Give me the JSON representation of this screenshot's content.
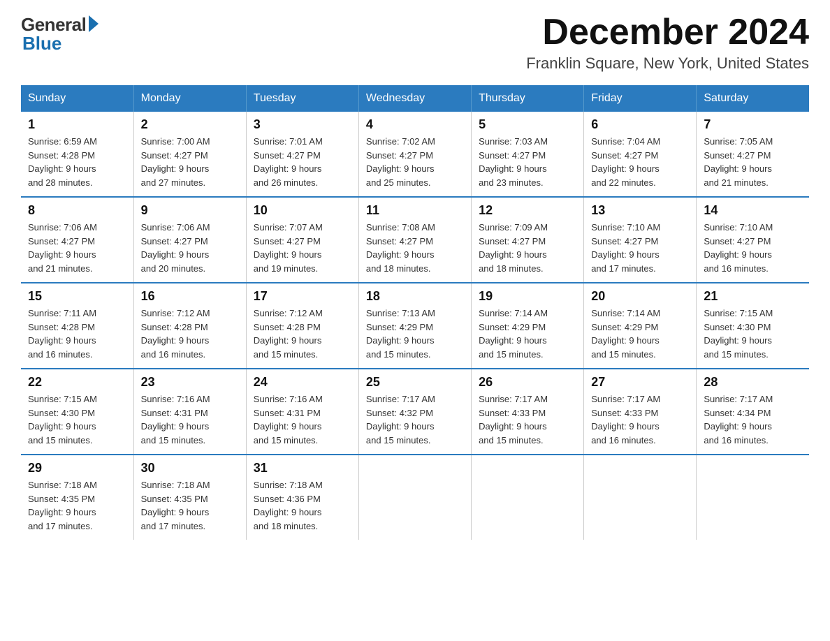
{
  "logo": {
    "general": "General",
    "blue": "Blue"
  },
  "title": {
    "month_year": "December 2024",
    "location": "Franklin Square, New York, United States"
  },
  "headers": [
    "Sunday",
    "Monday",
    "Tuesday",
    "Wednesday",
    "Thursday",
    "Friday",
    "Saturday"
  ],
  "weeks": [
    [
      {
        "day": "1",
        "sunrise": "6:59 AM",
        "sunset": "4:28 PM",
        "daylight": "9 hours and 28 minutes."
      },
      {
        "day": "2",
        "sunrise": "7:00 AM",
        "sunset": "4:27 PM",
        "daylight": "9 hours and 27 minutes."
      },
      {
        "day": "3",
        "sunrise": "7:01 AM",
        "sunset": "4:27 PM",
        "daylight": "9 hours and 26 minutes."
      },
      {
        "day": "4",
        "sunrise": "7:02 AM",
        "sunset": "4:27 PM",
        "daylight": "9 hours and 25 minutes."
      },
      {
        "day": "5",
        "sunrise": "7:03 AM",
        "sunset": "4:27 PM",
        "daylight": "9 hours and 23 minutes."
      },
      {
        "day": "6",
        "sunrise": "7:04 AM",
        "sunset": "4:27 PM",
        "daylight": "9 hours and 22 minutes."
      },
      {
        "day": "7",
        "sunrise": "7:05 AM",
        "sunset": "4:27 PM",
        "daylight": "9 hours and 21 minutes."
      }
    ],
    [
      {
        "day": "8",
        "sunrise": "7:06 AM",
        "sunset": "4:27 PM",
        "daylight": "9 hours and 21 minutes."
      },
      {
        "day": "9",
        "sunrise": "7:06 AM",
        "sunset": "4:27 PM",
        "daylight": "9 hours and 20 minutes."
      },
      {
        "day": "10",
        "sunrise": "7:07 AM",
        "sunset": "4:27 PM",
        "daylight": "9 hours and 19 minutes."
      },
      {
        "day": "11",
        "sunrise": "7:08 AM",
        "sunset": "4:27 PM",
        "daylight": "9 hours and 18 minutes."
      },
      {
        "day": "12",
        "sunrise": "7:09 AM",
        "sunset": "4:27 PM",
        "daylight": "9 hours and 18 minutes."
      },
      {
        "day": "13",
        "sunrise": "7:10 AM",
        "sunset": "4:27 PM",
        "daylight": "9 hours and 17 minutes."
      },
      {
        "day": "14",
        "sunrise": "7:10 AM",
        "sunset": "4:27 PM",
        "daylight": "9 hours and 16 minutes."
      }
    ],
    [
      {
        "day": "15",
        "sunrise": "7:11 AM",
        "sunset": "4:28 PM",
        "daylight": "9 hours and 16 minutes."
      },
      {
        "day": "16",
        "sunrise": "7:12 AM",
        "sunset": "4:28 PM",
        "daylight": "9 hours and 16 minutes."
      },
      {
        "day": "17",
        "sunrise": "7:12 AM",
        "sunset": "4:28 PM",
        "daylight": "9 hours and 15 minutes."
      },
      {
        "day": "18",
        "sunrise": "7:13 AM",
        "sunset": "4:29 PM",
        "daylight": "9 hours and 15 minutes."
      },
      {
        "day": "19",
        "sunrise": "7:14 AM",
        "sunset": "4:29 PM",
        "daylight": "9 hours and 15 minutes."
      },
      {
        "day": "20",
        "sunrise": "7:14 AM",
        "sunset": "4:29 PM",
        "daylight": "9 hours and 15 minutes."
      },
      {
        "day": "21",
        "sunrise": "7:15 AM",
        "sunset": "4:30 PM",
        "daylight": "9 hours and 15 minutes."
      }
    ],
    [
      {
        "day": "22",
        "sunrise": "7:15 AM",
        "sunset": "4:30 PM",
        "daylight": "9 hours and 15 minutes."
      },
      {
        "day": "23",
        "sunrise": "7:16 AM",
        "sunset": "4:31 PM",
        "daylight": "9 hours and 15 minutes."
      },
      {
        "day": "24",
        "sunrise": "7:16 AM",
        "sunset": "4:31 PM",
        "daylight": "9 hours and 15 minutes."
      },
      {
        "day": "25",
        "sunrise": "7:17 AM",
        "sunset": "4:32 PM",
        "daylight": "9 hours and 15 minutes."
      },
      {
        "day": "26",
        "sunrise": "7:17 AM",
        "sunset": "4:33 PM",
        "daylight": "9 hours and 15 minutes."
      },
      {
        "day": "27",
        "sunrise": "7:17 AM",
        "sunset": "4:33 PM",
        "daylight": "9 hours and 16 minutes."
      },
      {
        "day": "28",
        "sunrise": "7:17 AM",
        "sunset": "4:34 PM",
        "daylight": "9 hours and 16 minutes."
      }
    ],
    [
      {
        "day": "29",
        "sunrise": "7:18 AM",
        "sunset": "4:35 PM",
        "daylight": "9 hours and 17 minutes."
      },
      {
        "day": "30",
        "sunrise": "7:18 AM",
        "sunset": "4:35 PM",
        "daylight": "9 hours and 17 minutes."
      },
      {
        "day": "31",
        "sunrise": "7:18 AM",
        "sunset": "4:36 PM",
        "daylight": "9 hours and 18 minutes."
      },
      null,
      null,
      null,
      null
    ]
  ],
  "labels": {
    "sunrise": "Sunrise:",
    "sunset": "Sunset:",
    "daylight": "Daylight:"
  }
}
